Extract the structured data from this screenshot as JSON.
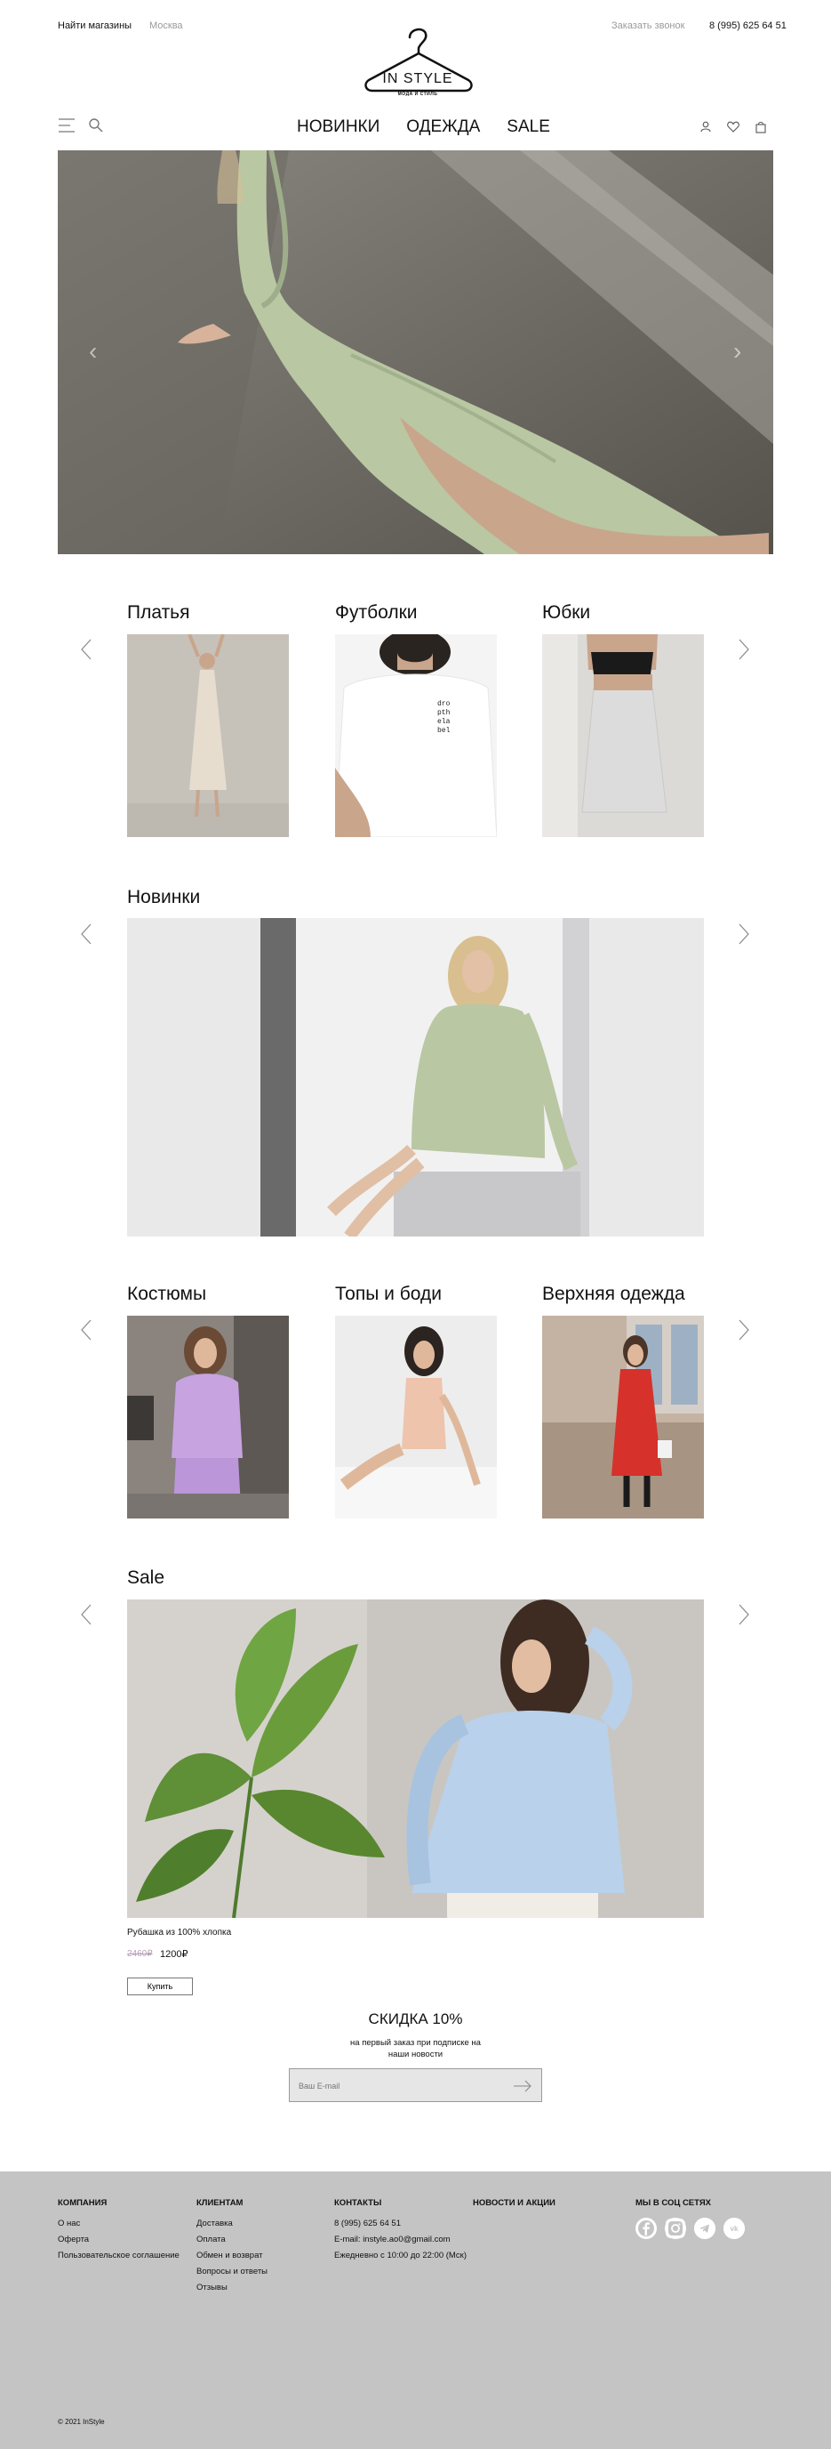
{
  "topbar": {
    "find_stores": "Найти магазины",
    "city": "Москва",
    "callback": "Заказать звонок",
    "phone": "8 (995) 625 64 51"
  },
  "logo": {
    "title": "IN STYLE",
    "tagline": "МОДА И СТИЛЬ"
  },
  "nav": {
    "items": [
      "НОВИНКИ",
      "ОДЕЖДА",
      "SALE"
    ]
  },
  "icons": {
    "menu": "menu-icon",
    "search": "search-icon",
    "account": "user-icon",
    "wishlist": "heart-icon",
    "cart": "bag-icon",
    "prev": "chevron-left-icon",
    "next": "chevron-right-icon"
  },
  "categories_top": [
    {
      "title": "Платья"
    },
    {
      "title": "Футболки"
    },
    {
      "title": "Юбки"
    }
  ],
  "tshirt_print": "dro\npth\nela\nbel",
  "new_section": {
    "title": "Новинки"
  },
  "categories_bottom": [
    {
      "title": "Костюмы"
    },
    {
      "title": "Топы и боди"
    },
    {
      "title": "Верхняя одежда"
    }
  ],
  "sale": {
    "title": "Sale",
    "product_name": "Рубашка из 100% хлопка",
    "old_price": "2460₽",
    "new_price": "1200₽",
    "buy_label": "Купить"
  },
  "subscribe": {
    "title": "СКИДКА 10%",
    "text_line1": "на первый заказ при подписке на",
    "text_line2": "наши новости",
    "placeholder": "Ваш E-mail"
  },
  "footer": {
    "company": {
      "title": "КОМПАНИЯ",
      "links": [
        "О нас",
        "Оферта",
        "Пользовательское соглашение"
      ]
    },
    "clients": {
      "title": "КЛИЕНТАМ",
      "links": [
        "Доставка",
        "Оплата",
        "Обмен и возврат",
        "Вопросы и  ответы",
        "Отзывы"
      ]
    },
    "contacts": {
      "title": "КОНТАКТЫ",
      "lines": [
        "8 (995) 625 64 51",
        "E-mail: instyle.ao0@gmail.com",
        "Ежедневно с 10:00 до 22:00 (Мск)"
      ]
    },
    "news": {
      "title": "НОВОСТИ И АКЦИИ"
    },
    "social": {
      "title": "МЫ В СОЦ СЕТЯХ",
      "items": [
        "facebook-icon",
        "instagram-icon",
        "telegram-icon",
        "vk-icon"
      ]
    },
    "copyright": "© 2021 InStyle"
  },
  "colors": {
    "footer_bg": "#c4c4c4",
    "old_price": "#b8a0b8",
    "dress_green": "#b9c7a3"
  }
}
